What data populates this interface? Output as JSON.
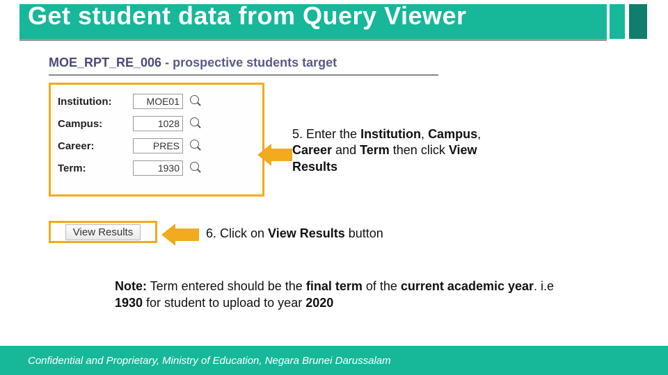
{
  "title": "Get student data from Query Viewer",
  "panel": {
    "code": "MOE_RPT_RE_006",
    "desc": " - prospective students target",
    "fields": {
      "institution": {
        "label": "Institution:",
        "value": "MOE01"
      },
      "campus": {
        "label": "Campus:",
        "value": "1028"
      },
      "career": {
        "label": "Career:",
        "value": "PRES"
      },
      "term": {
        "label": "Term:",
        "value": "1930"
      }
    },
    "view_results_label": "View Results"
  },
  "instructions": {
    "step5_pre": "5. Enter the ",
    "step5_b1": "Institution",
    "step5_mid1": ", ",
    "step5_b2": "Campus",
    "step5_mid2": ", ",
    "step5_b3": "Career",
    "step5_mid3": " and ",
    "step5_b4": "Term",
    "step5_mid4": " then click ",
    "step5_b5": "View Results",
    "step6_pre": "6. Click on ",
    "step6_b1": "View Results",
    "step6_post": " button"
  },
  "note": {
    "label": "Note:",
    "t1": " Term entered should be the ",
    "b1": "final term",
    "t2": " of the ",
    "b2": "current academic year",
    "t3": ". i.e ",
    "b3": "1930",
    "t4": " for student to upload to year ",
    "b4": "2020"
  },
  "footer": "Confidential and Proprietary, Ministry of Education, Negara Brunei Darussalam"
}
